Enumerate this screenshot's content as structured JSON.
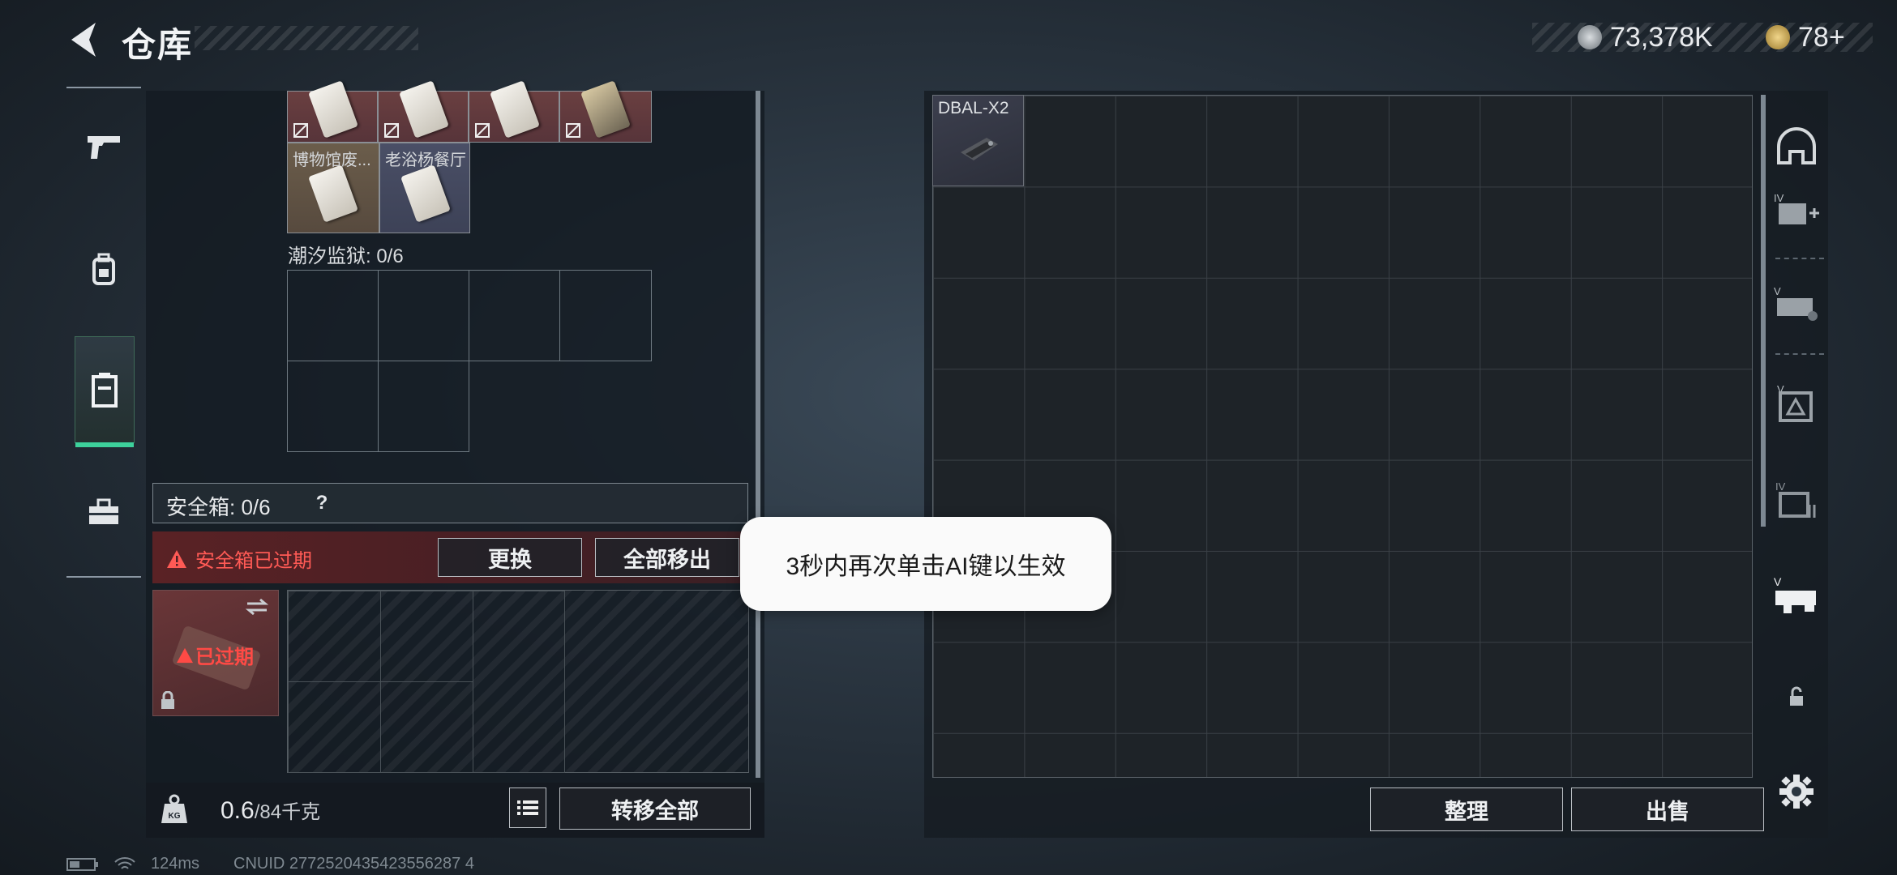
{
  "header": {
    "title": "仓库",
    "currency_1": "73,378K",
    "currency_2": "78+"
  },
  "leftnav": {
    "items": [
      {
        "name": "weapons",
        "icon": "pistol-icon"
      },
      {
        "name": "equipment",
        "icon": "backpack-icon"
      },
      {
        "name": "containers",
        "icon": "case-icon",
        "active": true
      },
      {
        "name": "toolbox",
        "icon": "toolbox-icon"
      }
    ]
  },
  "cards": {
    "museum": "博物馆废...",
    "restaurant": "老浴杨餐厅"
  },
  "prison": {
    "label": "潮汐监狱: 0/6"
  },
  "safe_box": {
    "label": "安全箱: 0/6",
    "help": "?",
    "expired_text": "安全箱已过期",
    "replace_button": "更换",
    "remove_all_button": "全部移出",
    "item_status": "已过期"
  },
  "bottom_left": {
    "weight_value": "0.6",
    "weight_unit": "/84千克",
    "transfer_all_button": "转移全部"
  },
  "right": {
    "item_label": "DBAL-X2",
    "sort_button": "整理",
    "sell_button": "出售"
  },
  "toast": {
    "text": "3秒内再次单击AI键以生效"
  },
  "status": {
    "ping": "124ms",
    "uid": "CNUID 2772520435423556287 4"
  },
  "colors": {
    "accent_green": "#3dd19b",
    "expired_red": "#ff5a55"
  }
}
